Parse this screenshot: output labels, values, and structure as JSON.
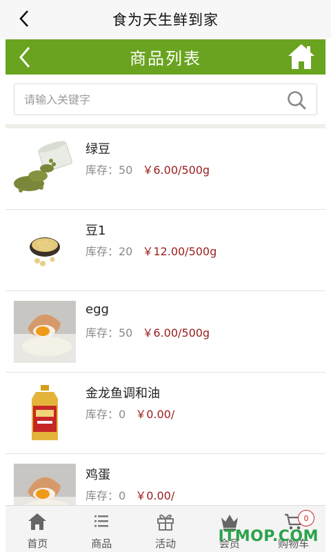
{
  "header": {
    "title": "食为天生鲜到家",
    "back_icon": "back-arrow-icon"
  },
  "navbar": {
    "title": "商品列表",
    "back_icon": "back-arrow-icon",
    "home_icon": "home-icon",
    "color": "#6aa31f"
  },
  "search": {
    "placeholder": "请输入关键字",
    "value": "",
    "icon": "search-icon"
  },
  "products": [
    {
      "name": "绿豆",
      "stock_label": "库存：50",
      "price": "￥6.00/500g",
      "image": "mung-beans"
    },
    {
      "name": "豆1",
      "stock_label": "库存：20",
      "price": "￥12.00/500g",
      "image": "soybeans"
    },
    {
      "name": "egg",
      "stock_label": "库存：50",
      "price": "￥6.00/500g",
      "image": "egg"
    },
    {
      "name": "金龙鱼调和油",
      "stock_label": "库存：0",
      "price": "￥0.00/",
      "image": "oil-bottle"
    },
    {
      "name": "鸡蛋",
      "stock_label": "库存：0",
      "price": "￥0.00/",
      "image": "egg"
    }
  ],
  "tabbar": {
    "tabs": [
      {
        "label": "首页",
        "icon": "home-icon"
      },
      {
        "label": "商品",
        "icon": "list-icon"
      },
      {
        "label": "活动",
        "icon": "gift-icon"
      },
      {
        "label": "会员",
        "icon": "crown-icon"
      },
      {
        "label": "购物车",
        "icon": "cart-icon",
        "badge": "0"
      }
    ]
  },
  "watermark": "ITMOP.COM",
  "colors": {
    "accent": "#6aa31f",
    "price": "#9b1c1c"
  }
}
